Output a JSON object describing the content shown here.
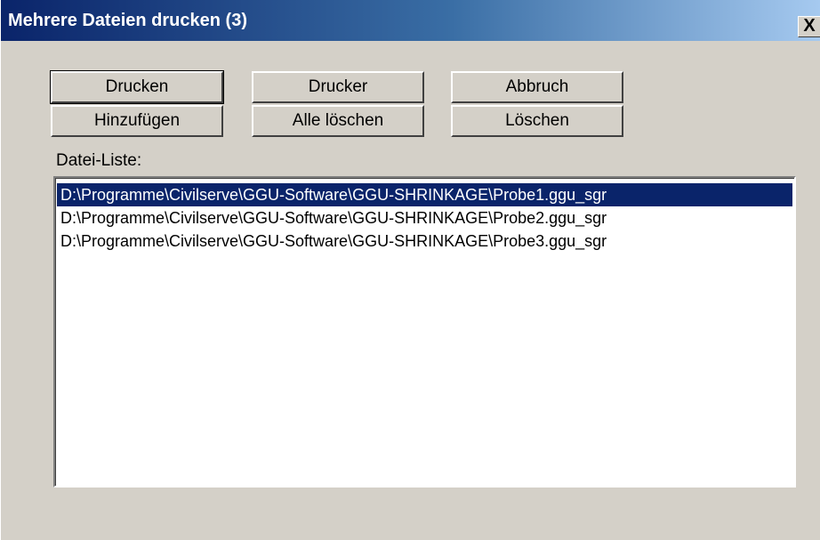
{
  "window": {
    "title": "Mehrere Dateien drucken (3)",
    "close_label": "X"
  },
  "buttons": {
    "print": "Drucken",
    "printer": "Drucker",
    "cancel": "Abbruch",
    "add": "Hinzufügen",
    "delete_all": "Alle löschen",
    "delete": "Löschen"
  },
  "file_list": {
    "label": "Datei-Liste:",
    "items": [
      "D:\\Programme\\Civilserve\\GGU-Software\\GGU-SHRINKAGE\\Probe1.ggu_sgr",
      "D:\\Programme\\Civilserve\\GGU-Software\\GGU-SHRINKAGE\\Probe2.ggu_sgr",
      "D:\\Programme\\Civilserve\\GGU-Software\\GGU-SHRINKAGE\\Probe3.ggu_sgr"
    ],
    "selected_index": 0
  },
  "colors": {
    "title_gradient_start": "#0a246a",
    "title_gradient_end": "#a6caf0",
    "selection": "#0a246a",
    "dialog_face": "#d4d0c8"
  }
}
